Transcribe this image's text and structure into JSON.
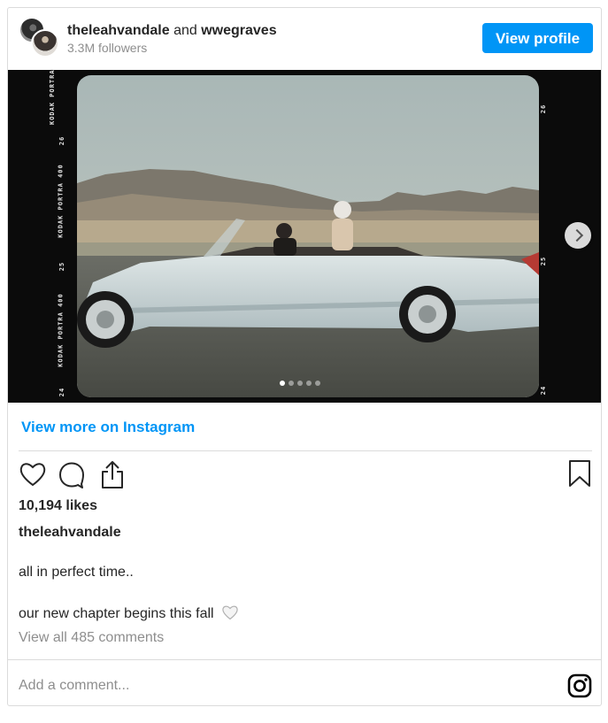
{
  "header": {
    "user1": "theleahvandale",
    "conjunction": "and",
    "user2": "wwegraves",
    "followers": "3.3M followers",
    "view_profile_label": "View profile"
  },
  "media": {
    "film_labels": {
      "left_top": "KODAK PORTRA",
      "left_26": "26",
      "left_mid": "KODAK PORTRA 400",
      "left_25": "25",
      "left_low": "KODAK PORTRA 400",
      "left_24": "24",
      "right_26": "26",
      "right_25": "25",
      "right_24": "24"
    },
    "carousel": {
      "total": 5,
      "active_index": 0
    }
  },
  "view_more_label": "View more on Instagram",
  "post": {
    "likes": "10,194 likes",
    "caption_user": "theleahvandale",
    "caption_line1": "all in perfect time..",
    "caption_line2": "our new chapter begins this fall",
    "view_comments": "View all 485 comments"
  },
  "comment_box": {
    "placeholder": "Add a comment..."
  },
  "colors": {
    "accent": "#0095f6",
    "text": "#262626",
    "muted": "#8e8e8e",
    "border": "#dbdbdb"
  },
  "icons": [
    "heart-icon",
    "comment-icon",
    "share-icon",
    "bookmark-icon",
    "instagram-icon",
    "chevron-right-icon"
  ]
}
